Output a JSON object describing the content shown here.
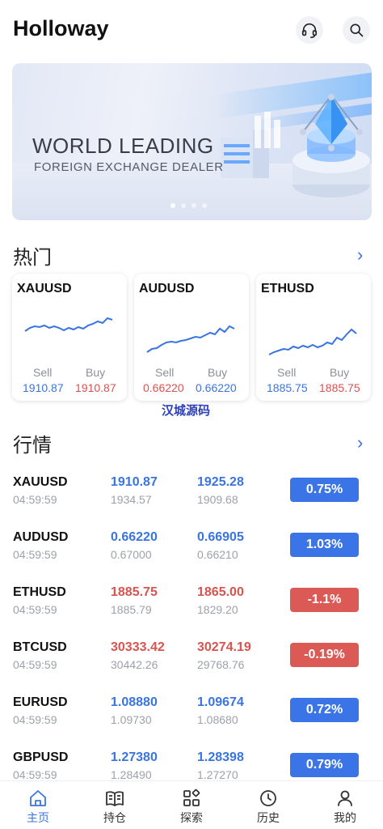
{
  "app": {
    "title": "Holloway"
  },
  "header": {
    "support_icon": "headset-icon",
    "search_icon": "search-icon"
  },
  "banner": {
    "title": "WORLD LEADING",
    "subtitle": "FOREIGN EXCHANGE DEALER",
    "slides": 4,
    "active_slide": 1
  },
  "hot": {
    "title": "热门",
    "more": "›",
    "sell_label": "Sell",
    "buy_label": "Buy",
    "cards": [
      {
        "symbol": "XAUUSD",
        "sell": "1910.87",
        "buy": "1910.87",
        "sell_color": "#3a74e0",
        "buy_color": "#d9534f"
      },
      {
        "symbol": "AUDUSD",
        "sell": "0.66220",
        "buy": "0.66220",
        "sell_color": "#d9534f",
        "buy_color": "#3a74e0"
      },
      {
        "symbol": "ETHUSD",
        "sell": "1885.75",
        "buy": "1885.75",
        "sell_color": "#3a74e0",
        "buy_color": "#d9534f"
      }
    ]
  },
  "watermark": "汉城源码",
  "market": {
    "title": "行情",
    "more": "›",
    "rows": [
      {
        "symbol": "XAUUSD",
        "time": "04:59:59",
        "price1": "1910.87",
        "sub1": "1934.57",
        "price2": "1925.28",
        "sub2": "1909.68",
        "change": "0.75%",
        "dir": "up"
      },
      {
        "symbol": "AUDUSD",
        "time": "04:59:59",
        "price1": "0.66220",
        "sub1": "0.67000",
        "price2": "0.66905",
        "sub2": "0.66210",
        "change": "1.03%",
        "dir": "up"
      },
      {
        "symbol": "ETHUSD",
        "time": "04:59:59",
        "price1": "1885.75",
        "sub1": "1885.79",
        "price2": "1865.00",
        "sub2": "1829.20",
        "change": "-1.1%",
        "dir": "down"
      },
      {
        "symbol": "BTCUSD",
        "time": "04:59:59",
        "price1": "30333.42",
        "sub1": "30442.26",
        "price2": "30274.19",
        "sub2": "29768.76",
        "change": "-0.19%",
        "dir": "down"
      },
      {
        "symbol": "EURUSD",
        "time": "04:59:59",
        "price1": "1.08880",
        "sub1": "1.09730",
        "price2": "1.09674",
        "sub2": "1.08680",
        "change": "0.72%",
        "dir": "up"
      },
      {
        "symbol": "GBPUSD",
        "time": "04:59:59",
        "price1": "1.27380",
        "sub1": "1.28490",
        "price2": "1.28398",
        "sub2": "1.27270",
        "change": "0.79%",
        "dir": "up"
      }
    ]
  },
  "tabs": [
    {
      "label": "主页",
      "icon": "home-icon",
      "active": true
    },
    {
      "label": "持仓",
      "icon": "book-icon",
      "active": false
    },
    {
      "label": "探索",
      "icon": "grid-icon",
      "active": false
    },
    {
      "label": "历史",
      "icon": "clock-icon",
      "active": false
    },
    {
      "label": "我的",
      "icon": "user-icon",
      "active": false
    }
  ]
}
